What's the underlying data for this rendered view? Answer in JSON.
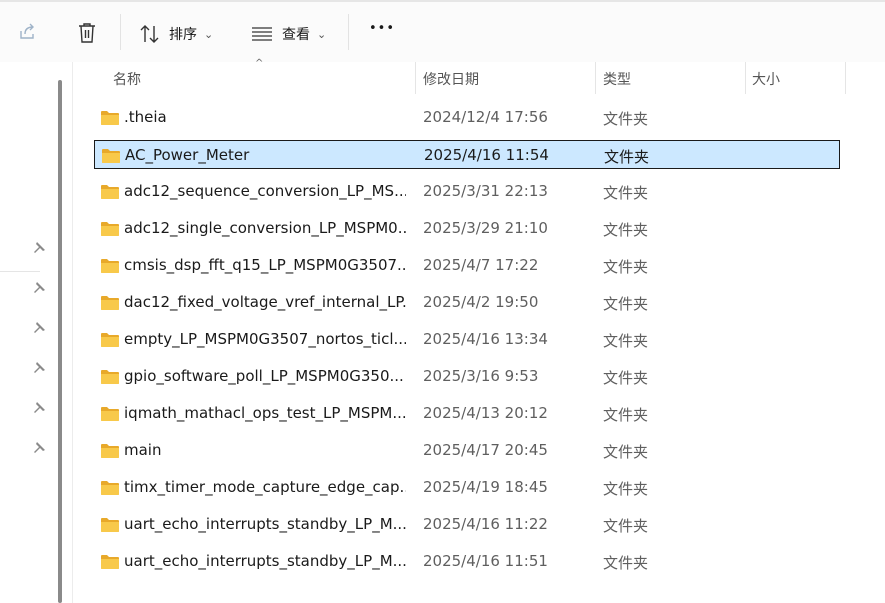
{
  "toolbar": {
    "share_icon": "share-icon",
    "delete_icon": "trash-icon",
    "sort_label": "排序",
    "view_label": "查看",
    "more_label": "•••"
  },
  "columns": {
    "name": "名称",
    "modified": "修改日期",
    "type": "类型",
    "size": "大小"
  },
  "colors": {
    "selected_bg": "#cce8ff",
    "folder_yellow": "#f8c94a"
  },
  "files": [
    {
      "name": ".theia",
      "modified": "2024/12/4 17:56",
      "type": "文件夹",
      "selected": false
    },
    {
      "name": "AC_Power_Meter",
      "modified": "2025/4/16 11:54",
      "type": "文件夹",
      "selected": true
    },
    {
      "name": "adc12_sequence_conversion_LP_MS...",
      "modified": "2025/3/31 22:13",
      "type": "文件夹",
      "selected": false
    },
    {
      "name": "adc12_single_conversion_LP_MSPM0...",
      "modified": "2025/3/29 21:10",
      "type": "文件夹",
      "selected": false
    },
    {
      "name": "cmsis_dsp_fft_q15_LP_MSPM0G3507...",
      "modified": "2025/4/7 17:22",
      "type": "文件夹",
      "selected": false
    },
    {
      "name": "dac12_fixed_voltage_vref_internal_LP...",
      "modified": "2025/4/2 19:50",
      "type": "文件夹",
      "selected": false
    },
    {
      "name": "empty_LP_MSPM0G3507_nortos_ticl...",
      "modified": "2025/4/16 13:34",
      "type": "文件夹",
      "selected": false
    },
    {
      "name": "gpio_software_poll_LP_MSPM0G350...",
      "modified": "2025/3/16 9:53",
      "type": "文件夹",
      "selected": false
    },
    {
      "name": "iqmath_mathacl_ops_test_LP_MSPM...",
      "modified": "2025/4/13 20:12",
      "type": "文件夹",
      "selected": false
    },
    {
      "name": "main",
      "modified": "2025/4/17 20:45",
      "type": "文件夹",
      "selected": false
    },
    {
      "name": "timx_timer_mode_capture_edge_cap...",
      "modified": "2025/4/19 18:45",
      "type": "文件夹",
      "selected": false
    },
    {
      "name": "uart_echo_interrupts_standby_LP_M...",
      "modified": "2025/4/16 11:22",
      "type": "文件夹",
      "selected": false
    },
    {
      "name": "uart_echo_interrupts_standby_LP_M...",
      "modified": "2025/4/16 11:51",
      "type": "文件夹",
      "selected": false
    }
  ]
}
